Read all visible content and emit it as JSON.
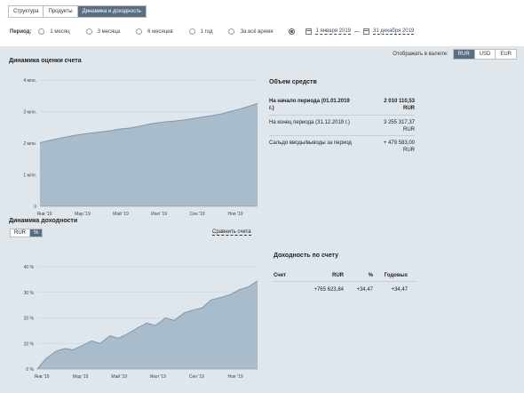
{
  "tabs": [
    {
      "label": "Структура",
      "active": false
    },
    {
      "label": "Продукты",
      "active": false
    },
    {
      "label": "Динамика и доходность",
      "active": true
    }
  ],
  "period": {
    "label": "Период:",
    "options": [
      "1 месяц",
      "3 месяца",
      "6 месяцев",
      "1 год",
      "За всё время"
    ],
    "date_from": "1 января 2019",
    "date_sep": "—",
    "date_to": "31 декабря 2019"
  },
  "currency": {
    "label": "Отображать в валюте:",
    "options": [
      "RUR",
      "USD",
      "EUR"
    ],
    "selected": "RUR"
  },
  "value_chart": {
    "title": "Динамика оценки счета",
    "chart_data": {
      "type": "area",
      "x_ticks": [
        "Янв '19",
        "Мар '19",
        "Май '19",
        "Июл '19",
        "Сен '19",
        "Ноя '19"
      ],
      "y_ticks": [
        "0",
        "1 млн.",
        "2 млн.",
        "3 млн.",
        "4 млн."
      ],
      "ylim": [
        0,
        4000000
      ],
      "x": [
        "2019-01-01",
        "2019-01-15",
        "2019-02-01",
        "2019-02-15",
        "2019-03-01",
        "2019-03-15",
        "2019-04-01",
        "2019-04-15",
        "2019-05-01",
        "2019-05-15",
        "2019-06-01",
        "2019-06-15",
        "2019-07-01",
        "2019-07-15",
        "2019-08-01",
        "2019-08-15",
        "2019-09-01",
        "2019-09-15",
        "2019-10-01",
        "2019-10-15",
        "2019-11-01",
        "2019-11-15",
        "2019-12-01",
        "2019-12-15",
        "2019-12-31"
      ],
      "values": [
        2010000,
        2080000,
        2150000,
        2200000,
        2250000,
        2290000,
        2330000,
        2360000,
        2400000,
        2450000,
        2480000,
        2530000,
        2600000,
        2640000,
        2680000,
        2700000,
        2740000,
        2780000,
        2830000,
        2870000,
        2930000,
        3000000,
        3080000,
        3160000,
        3255000
      ]
    }
  },
  "funds": {
    "title": "Объем средств",
    "rows": [
      {
        "label": "На начало периода (01.01.2019 г.)",
        "value": "2 010 110,53",
        "unit": "RUR",
        "bold": true
      },
      {
        "label": "На конец периода (31.12.2019 г.)",
        "value": "3 255 317,37",
        "unit": "RUR",
        "bold": false
      },
      {
        "label": "Сальдо вводы/выводы за период",
        "value": "+ 479 583,00",
        "unit": "RUR",
        "bold": false
      }
    ]
  },
  "return_chart": {
    "title": "Динамика доходности",
    "toggle": [
      "RUR",
      "%"
    ],
    "toggle_selected": "%",
    "compare_label": "Сравнить счета",
    "chart_data": {
      "type": "area",
      "x_ticks": [
        "Янв '19",
        "Мар '19",
        "Май '19",
        "Июл '19",
        "Сен '19",
        "Ноя '19"
      ],
      "y_ticks": [
        "0 %",
        "10 %",
        "20 %",
        "30 %",
        "40 %"
      ],
      "ylim": [
        0,
        40
      ],
      "x": [
        "2019-01-01",
        "2019-01-15",
        "2019-02-01",
        "2019-02-15",
        "2019-03-01",
        "2019-03-15",
        "2019-04-01",
        "2019-04-15",
        "2019-05-01",
        "2019-05-15",
        "2019-06-01",
        "2019-06-15",
        "2019-07-01",
        "2019-07-15",
        "2019-08-01",
        "2019-08-15",
        "2019-09-01",
        "2019-09-15",
        "2019-10-01",
        "2019-10-15",
        "2019-11-01",
        "2019-11-15",
        "2019-12-01",
        "2019-12-15",
        "2019-12-31"
      ],
      "values": [
        0,
        4,
        7,
        8,
        7.5,
        9,
        11,
        10,
        13,
        12,
        14,
        16,
        18,
        17,
        20,
        19,
        22,
        23,
        24,
        27,
        28,
        29,
        31,
        32,
        34.47
      ]
    }
  },
  "returns": {
    "title": "Доходность по счету",
    "headers": [
      "Счет",
      "RUR",
      "%",
      "Годовых"
    ],
    "row": [
      "",
      "+765 623,84",
      "+34,47",
      "+34,47"
    ]
  }
}
